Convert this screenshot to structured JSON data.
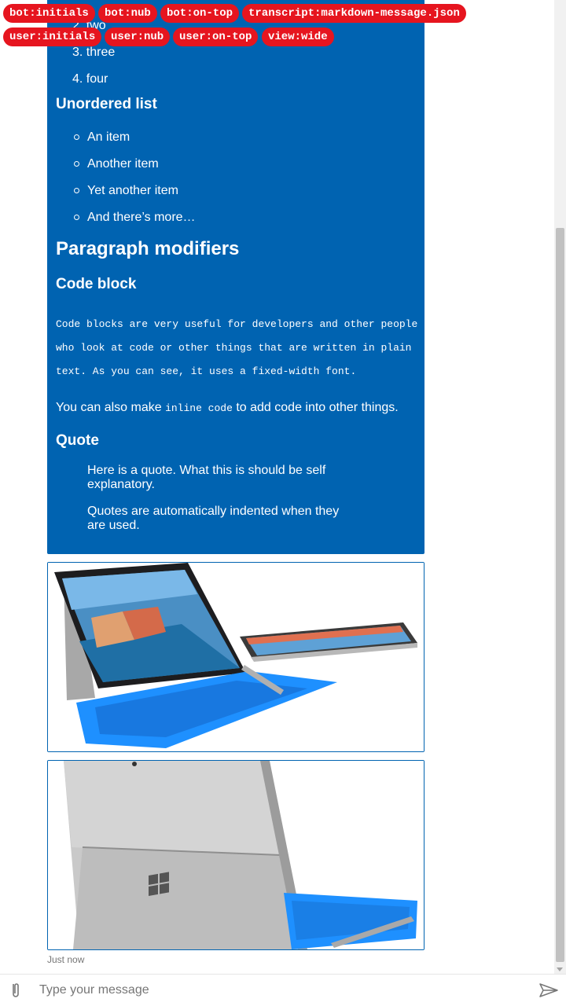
{
  "tags": [
    "bot:initials",
    "bot:nub",
    "bot:on-top",
    "transcript:markdown-message.json",
    "user:initials",
    "user:nub",
    "user:on-top",
    "view:wide"
  ],
  "message": {
    "ordered_list": [
      {
        "num": "2.",
        "text": "two"
      },
      {
        "num": "3.",
        "text": "three"
      },
      {
        "num": "4.",
        "text": "four"
      }
    ],
    "unordered_heading": "Unordered list",
    "unordered_list": [
      "An item",
      "Another item",
      "Yet another item",
      "And there’s more…"
    ],
    "paragraph_heading": "Paragraph modifiers",
    "code_heading": "Code block",
    "code_text": "Code blocks are very useful for developers and other people who look at code or other things that are written in plain text. As you can see, it uses a fixed-width font.",
    "inline_prefix": "You can also make ",
    "inline_code": "inline code",
    "inline_suffix": " to add code into other things.",
    "quote_heading": "Quote",
    "quotes": [
      "Here is a quote. What this is should be self explanatory.",
      "Quotes are automatically indented when they are used."
    ]
  },
  "timestamp": "Just now",
  "sendbox": {
    "placeholder": "Type your message"
  },
  "colors": {
    "bubble": "#0063b1",
    "tag": "#e6151f",
    "keyboard": "#1e90ff"
  }
}
